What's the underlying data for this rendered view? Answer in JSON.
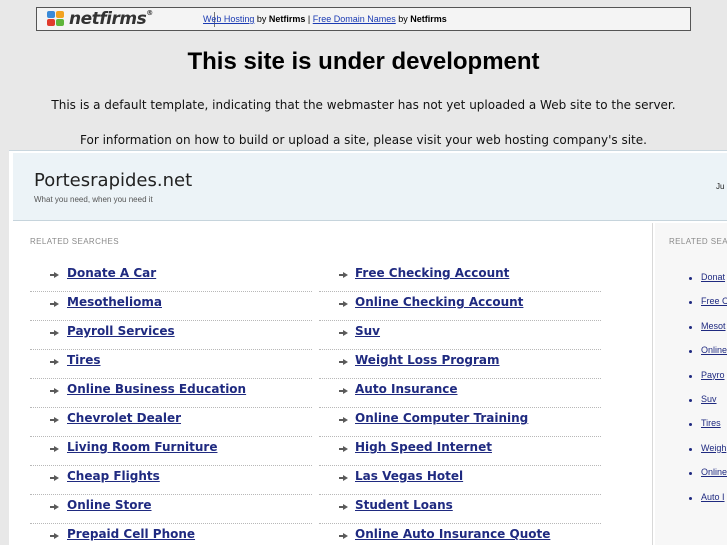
{
  "banner": {
    "logo_text": "netfirms",
    "logo_reg": "®",
    "link1": "Web Hosting",
    "by1": " by ",
    "brand1": "Netfirms",
    "sep": " | ",
    "link2": "Free Domain Names",
    "by2": " by ",
    "brand2": "Netfirms"
  },
  "headline": "This site is under development",
  "info_line1": "This is a default template, indicating that the webmaster has not yet uploaded a Web site to the server.",
  "info_line2": "For information on how to build or upload a site, please visit your web hosting company's site.",
  "parked": {
    "site_title": "Portesrapides.net",
    "tagline": "What you need, when you need it",
    "header_clip": "Ju",
    "section_label": "RELATED SEARCHES",
    "left_items": [
      "Donate A Car",
      "Mesothelioma",
      "Payroll Services",
      "Tires",
      "Online Business Education",
      "Chevrolet Dealer",
      "Living Room Furniture",
      "Cheap Flights",
      "Online Store",
      "Prepaid Cell Phone"
    ],
    "right_items": [
      "Free Checking Account",
      "Online Checking Account",
      "Suv",
      "Weight Loss Program",
      "Auto Insurance",
      "Online Computer Training",
      "High Speed Internet",
      "Las Vegas Hotel",
      "Student Loans",
      "Online Auto Insurance Quote"
    ],
    "side_label": "RELATED SEA",
    "side_items": [
      "Donat",
      "Free C",
      "Mesot",
      "Online",
      "Payro",
      "Suv",
      "Tires",
      "Weigh",
      "Online",
      "Auto I"
    ]
  },
  "colors": {
    "link": "#1f2a80",
    "banner_link": "#1b3bb3",
    "header_bg": "#ecf3f7",
    "page_bg": "#e8e8e8"
  }
}
